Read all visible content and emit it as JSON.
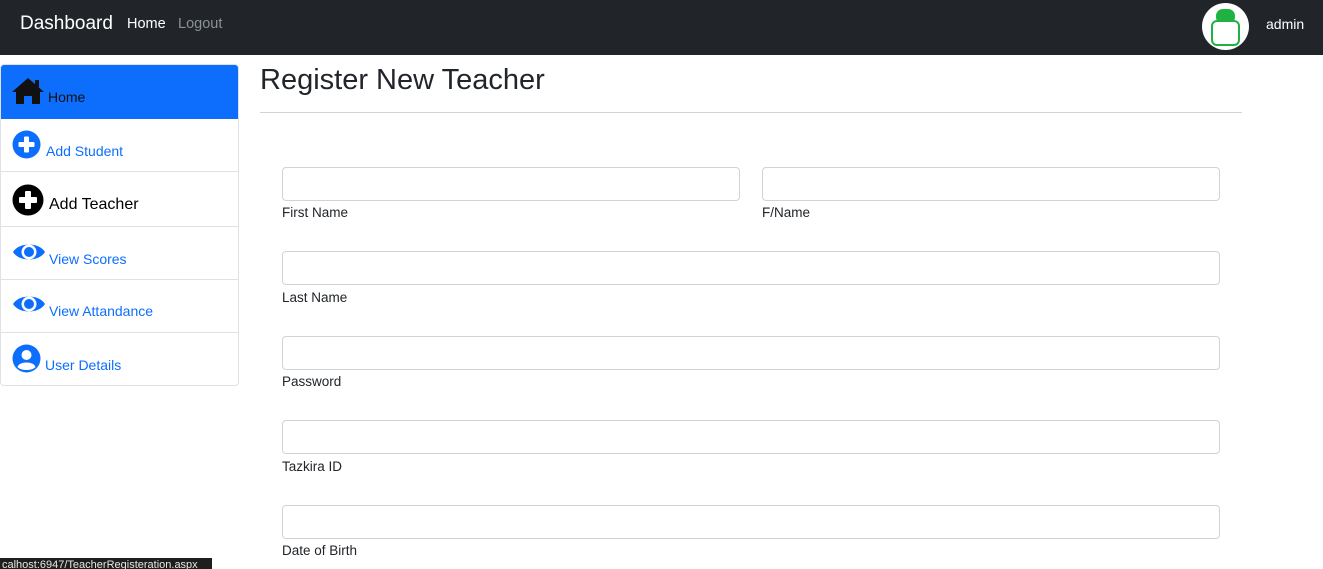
{
  "navbar": {
    "brand": "Dashboard",
    "links": [
      {
        "label": "Home",
        "active": true
      },
      {
        "label": "Logout",
        "active": false
      }
    ],
    "user": {
      "name": "admin",
      "avatar_icon": "user-avatar-icon"
    }
  },
  "sidebar": {
    "items": [
      {
        "label": "Home",
        "icon": "home-icon",
        "active": true
      },
      {
        "label": "Add Student",
        "icon": "plus-circle-icon"
      },
      {
        "label": "Add Teacher",
        "icon": "plus-circle-icon",
        "current": true
      },
      {
        "label": "View Scores",
        "icon": "eye-icon"
      },
      {
        "label": "View Attandance",
        "icon": "eye-icon"
      },
      {
        "label": "User Details",
        "icon": "user-circle-icon"
      }
    ]
  },
  "main": {
    "title": "Register New Teacher",
    "fields": [
      {
        "label": "First Name",
        "value": ""
      },
      {
        "label": "F/Name",
        "value": ""
      },
      {
        "label": "Last Name",
        "value": ""
      },
      {
        "label": "Password",
        "value": ""
      },
      {
        "label": "Tazkira ID",
        "value": ""
      },
      {
        "label": "Date of Birth",
        "value": ""
      }
    ]
  },
  "status_bar": {
    "url": "calhost:6947/TeacherRegisteration.aspx"
  },
  "colors": {
    "navbar_bg": "#212529",
    "accent": "#0d6efd",
    "avatar_green": "#1fb141"
  }
}
